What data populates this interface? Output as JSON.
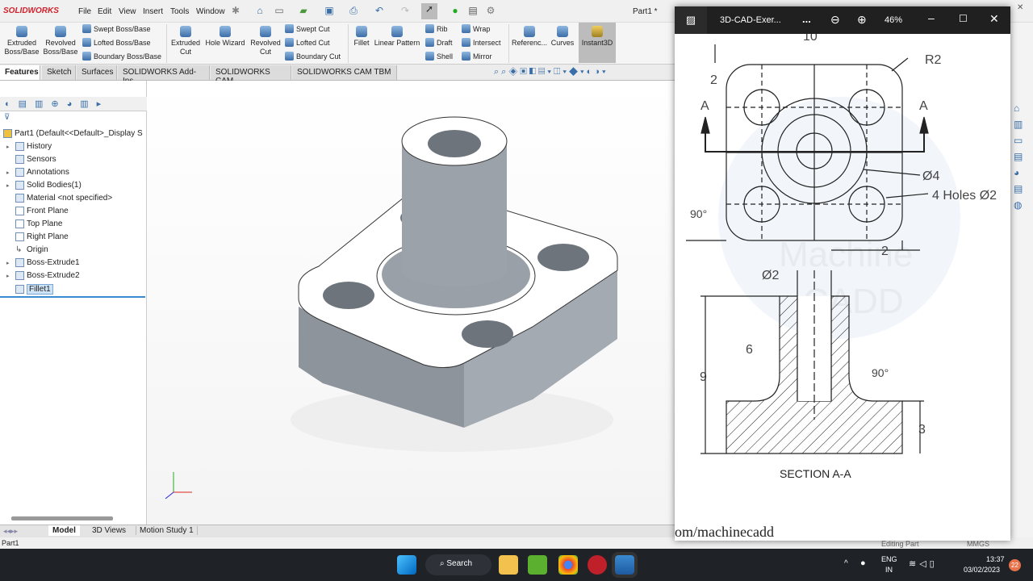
{
  "app": {
    "logo": "SOLIDWORKS",
    "doc_title": "Part1 *",
    "menus": [
      "File",
      "Edit",
      "View",
      "Insert",
      "Tools",
      "Window"
    ]
  },
  "command_manager": {
    "large": [
      {
        "label": "Extruded Boss/Base"
      },
      {
        "label": "Revolved Boss/Base"
      },
      {
        "label": "Extruded Cut"
      },
      {
        "label": "Hole Wizard"
      },
      {
        "label": "Revolved Cut"
      },
      {
        "label": "Fillet"
      },
      {
        "label": "Linear Pattern"
      },
      {
        "label": "Referenc..."
      },
      {
        "label": "Curves"
      },
      {
        "label": "Instant3D"
      }
    ],
    "small": [
      "Swept Boss/Base",
      "Lofted Boss/Base",
      "Boundary Boss/Base",
      "Swept Cut",
      "Lofted Cut",
      "Boundary Cut",
      "Rib",
      "Draft",
      "Shell",
      "Wrap",
      "Intersect",
      "Mirror"
    ]
  },
  "tabs": [
    "Features",
    "Sketch",
    "Surfaces",
    "SOLIDWORKS Add-Ins",
    "SOLIDWORKS CAM",
    "SOLIDWORKS CAM TBM"
  ],
  "tree": {
    "root": "Part1  (Default<<Default>_Display S",
    "items": [
      "History",
      "Sensors",
      "Annotations",
      "Solid Bodies(1)",
      "Material <not specified>",
      "Front Plane",
      "Top Plane",
      "Right Plane",
      "Origin",
      "Boss-Extrude1",
      "Boss-Extrude2",
      "Fillet1"
    ]
  },
  "bottom_tabs": [
    "Model",
    "3D Views",
    "Motion Study 1"
  ],
  "status": {
    "left": "Part1",
    "editing": "Editing Part",
    "units": "MMGS"
  },
  "photos": {
    "title": "3D-CAD-Exer...",
    "more": "...",
    "zoom": "46%",
    "drawing": {
      "top_dim": "10",
      "d_2": "2",
      "r2": "R2",
      "sec_a1": "A",
      "sec_a2": "A",
      "d4": "Ø4",
      "holes": "4 Holes  Ø2",
      "angle1": "90°",
      "d_2b": "2",
      "d2": "Ø2",
      "h6": "6",
      "h9": "9",
      "angle2": "90°",
      "h3": "3",
      "section": "SECTION A-A",
      "watermark1": "Machine",
      "watermark2": "CADD",
      "url": "om/machinecadd"
    }
  },
  "taskbar": {
    "search": "Search",
    "lang1": "ENG",
    "lang2": "IN",
    "time": "13:37",
    "date": "03/02/2023",
    "badge": "22"
  }
}
